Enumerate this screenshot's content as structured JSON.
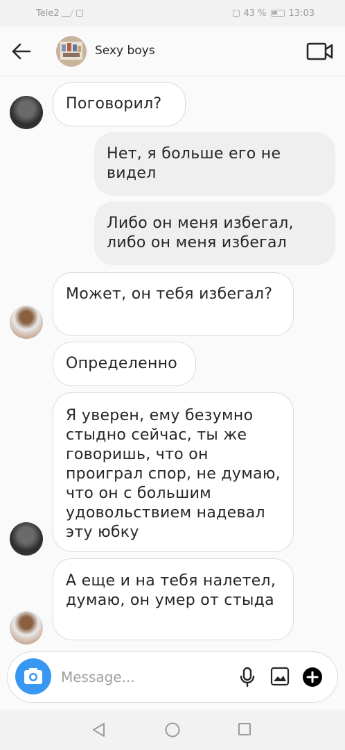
{
  "status_bar": {
    "carrier": "Tele2",
    "battery": "43 %",
    "time": "13:03"
  },
  "header": {
    "group_name": "Sexy boys",
    "back_icon": "arrow-left-icon",
    "video_icon": "video-camera-icon"
  },
  "messages": [
    {
      "sender": "a",
      "direction": "in",
      "text": "Поговорил?"
    },
    {
      "direction": "out",
      "text": "Нет, я больше его не видел"
    },
    {
      "direction": "out",
      "text": "Либо он меня избегал, либо он меня избегал"
    },
    {
      "sender": "b",
      "direction": "in",
      "text": "Может, он тебя избегал?"
    },
    {
      "sender": "a",
      "direction": "in",
      "text": "Определенно"
    },
    {
      "sender": "a",
      "direction": "in",
      "text": "Я уверен, ему безумно стыдно сейчас, ты же говоришь, что он проиграл спор, не думаю, что он с большим удовольствием надевал эту юбку"
    },
    {
      "sender": "b",
      "direction": "in",
      "text": "А еще и на тебя налетел, думаю, он умер от стыда"
    }
  ],
  "composer": {
    "placeholder": "Message...",
    "camera_icon": "camera-icon",
    "mic_icon": "microphone-icon",
    "gallery_icon": "gallery-icon",
    "plus_icon": "plus-circle-icon",
    "accent_color": "#3897f0"
  },
  "navbar": {
    "back_icon": "triangle-back-icon",
    "home_icon": "circle-home-icon",
    "recent_icon": "square-recents-icon"
  }
}
